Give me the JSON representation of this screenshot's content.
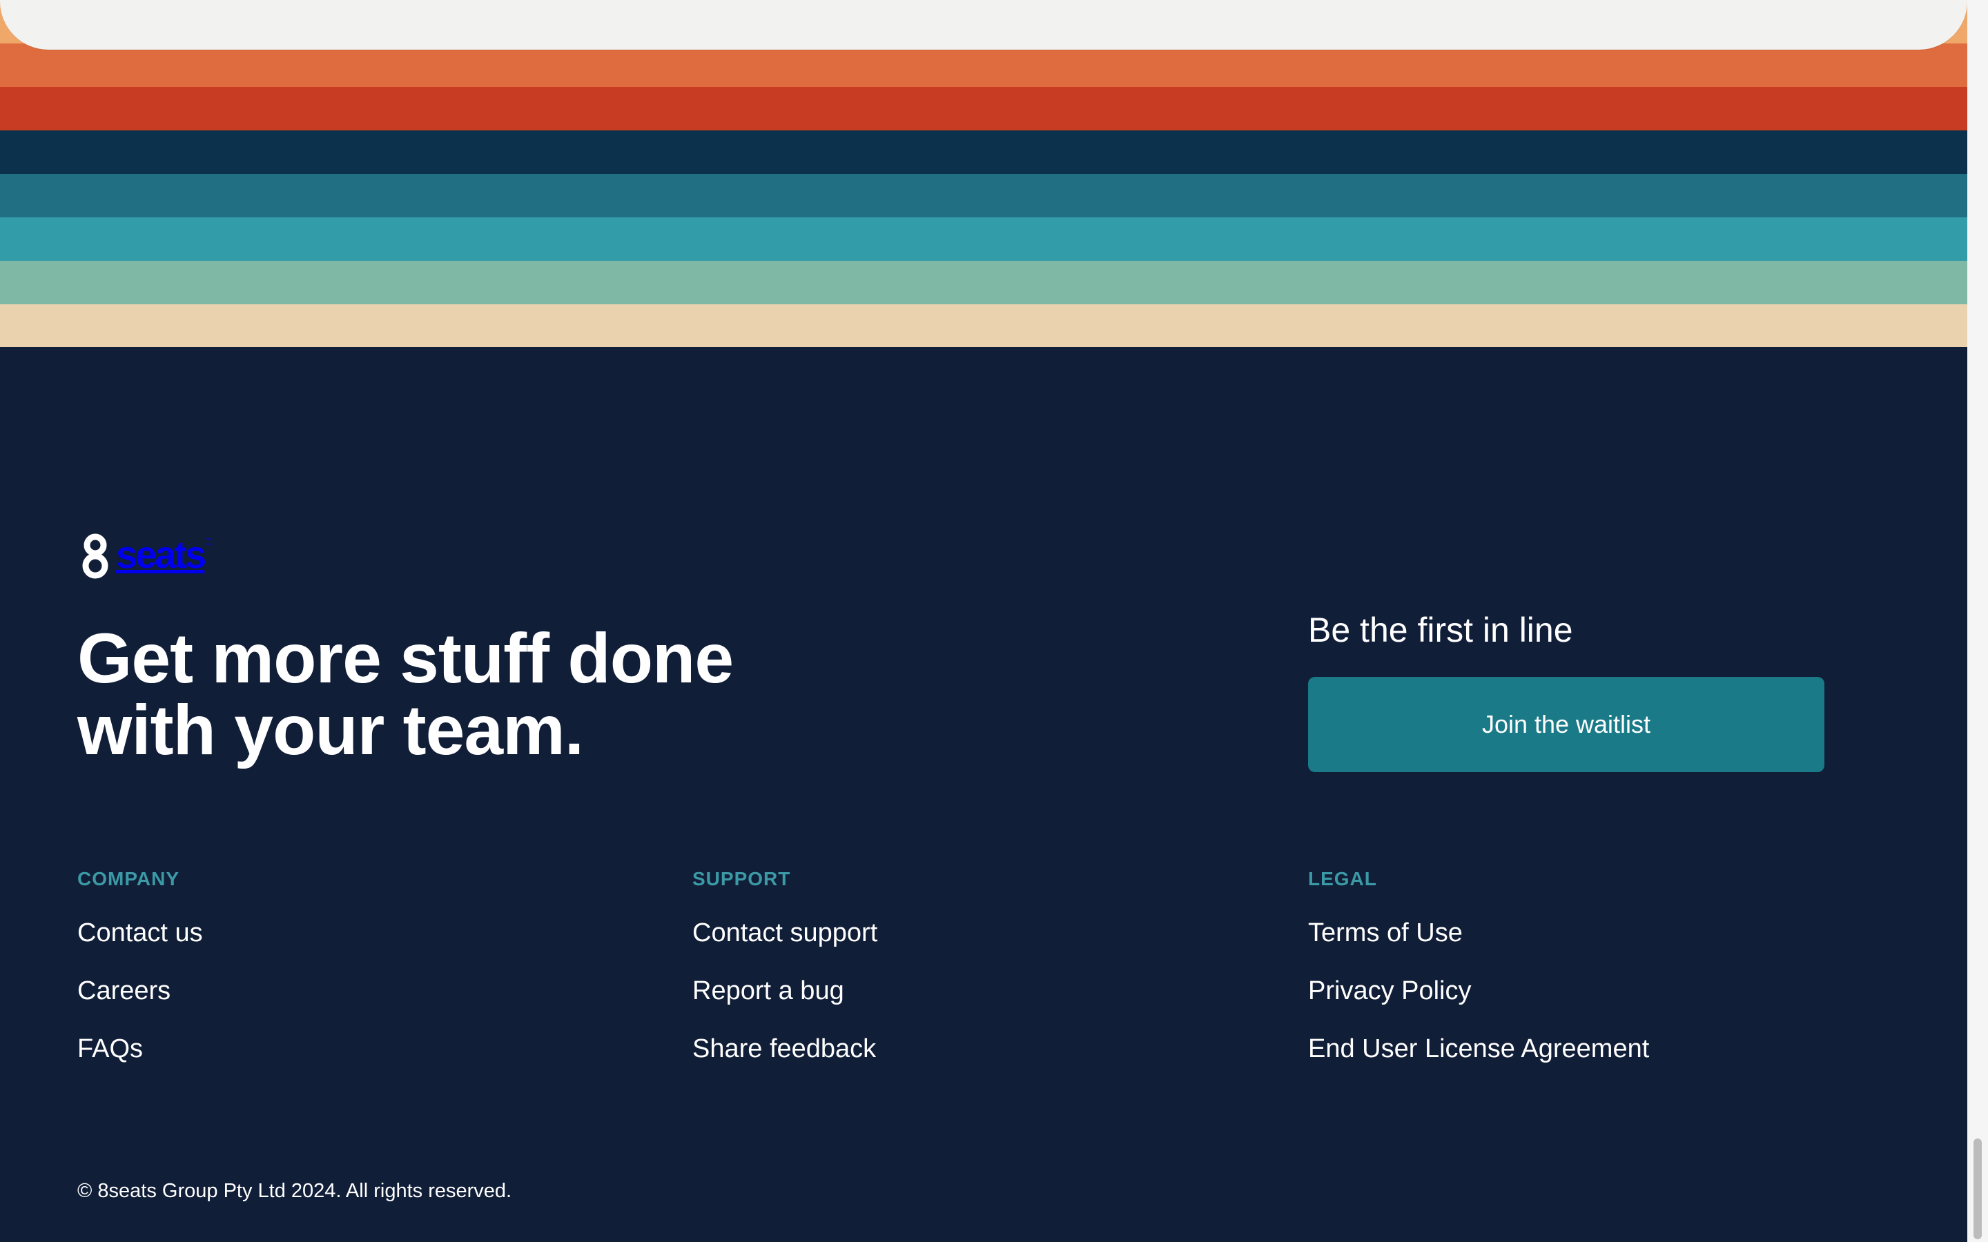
{
  "brand": {
    "name": "8seats",
    "logo_text": "seats",
    "trademark": "™"
  },
  "hero": {
    "headline_line1": "Get more stuff done",
    "headline_line2": "with your team."
  },
  "cta": {
    "title": "Be the first in line",
    "button_label": "Join the waitlist"
  },
  "footer": {
    "columns": [
      {
        "title": "COMPANY",
        "links": [
          "Contact us",
          "Careers",
          "FAQs"
        ]
      },
      {
        "title": "SUPPORT",
        "links": [
          "Contact support",
          "Report a bug",
          "Share feedback"
        ]
      },
      {
        "title": "LEGAL",
        "links": [
          "Terms of Use",
          "Privacy Policy",
          "End User License Agreement"
        ]
      }
    ],
    "copyright": "© 8seats Group Pty Ltd 2024. All rights reserved."
  },
  "colors": {
    "background": "#111e38",
    "accent": "#1b7a88",
    "column_heading": "#3b9aa6",
    "stripe_1": "#efa76a",
    "stripe_2": "#df6c3e",
    "stripe_3": "#c93c24",
    "stripe_4": "#0b314c",
    "stripe_5": "#216f82",
    "stripe_6": "#339ca9",
    "stripe_7": "#7fb8a5",
    "stripe_8": "#ebd2ae"
  },
  "icons": {
    "logo_mark": "figure-eight-logo-icon"
  }
}
